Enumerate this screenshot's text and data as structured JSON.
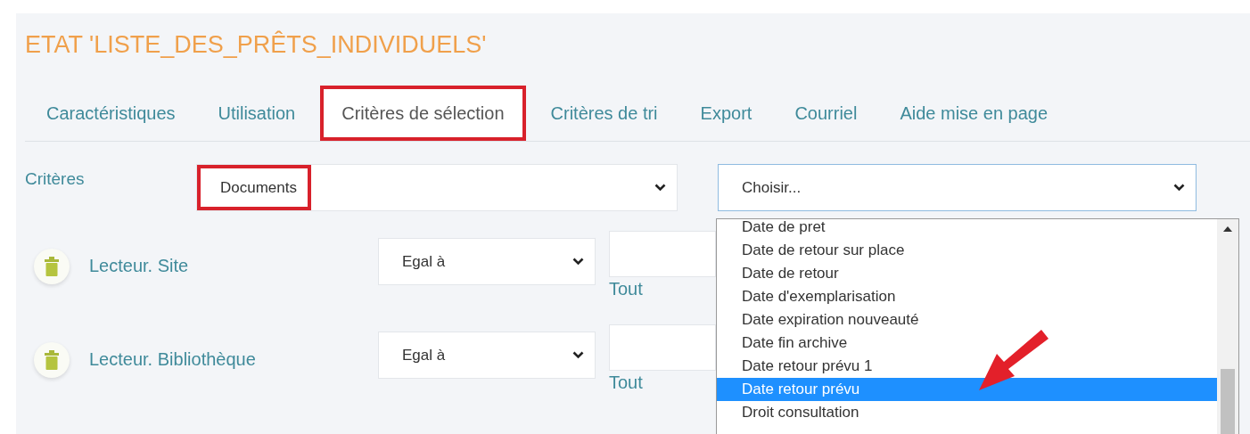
{
  "title": "ETAT 'LISTE_DES_PRÊTS_INDIVIDUELS'",
  "tabs": [
    {
      "label": "Caractéristiques",
      "selected": false,
      "highlighted": false
    },
    {
      "label": "Utilisation",
      "selected": false,
      "highlighted": false
    },
    {
      "label": "Critères de sélection",
      "selected": true,
      "highlighted": true
    },
    {
      "label": "Critères de tri",
      "selected": false,
      "highlighted": false
    },
    {
      "label": "Export",
      "selected": false,
      "highlighted": false
    },
    {
      "label": "Courriel",
      "selected": false,
      "highlighted": false
    },
    {
      "label": "Aide mise en page",
      "selected": false,
      "highlighted": false
    }
  ],
  "criteria": {
    "label": "Critères",
    "category_select": {
      "value": "Documents",
      "highlighted": true
    },
    "field_select": {
      "value": "Choisir...",
      "expanded": true
    }
  },
  "dropdown_options": [
    {
      "label": "Date de pret",
      "selected": false
    },
    {
      "label": "Date de retour sur place",
      "selected": false
    },
    {
      "label": "Date de retour",
      "selected": false
    },
    {
      "label": "Date d'exemplarisation",
      "selected": false
    },
    {
      "label": "Date expiration nouveauté",
      "selected": false
    },
    {
      "label": "Date fin archive",
      "selected": false
    },
    {
      "label": "Date retour prévu 1",
      "selected": false
    },
    {
      "label": "Date retour prévu",
      "selected": true
    },
    {
      "label": "Droit consultation",
      "selected": false
    }
  ],
  "rows": [
    {
      "label": "Lecteur. Site",
      "operator": "Egal à",
      "link": "Tout"
    },
    {
      "label": "Lecteur. Bibliothèque",
      "operator": "Egal à",
      "link": "Tout"
    }
  ]
}
